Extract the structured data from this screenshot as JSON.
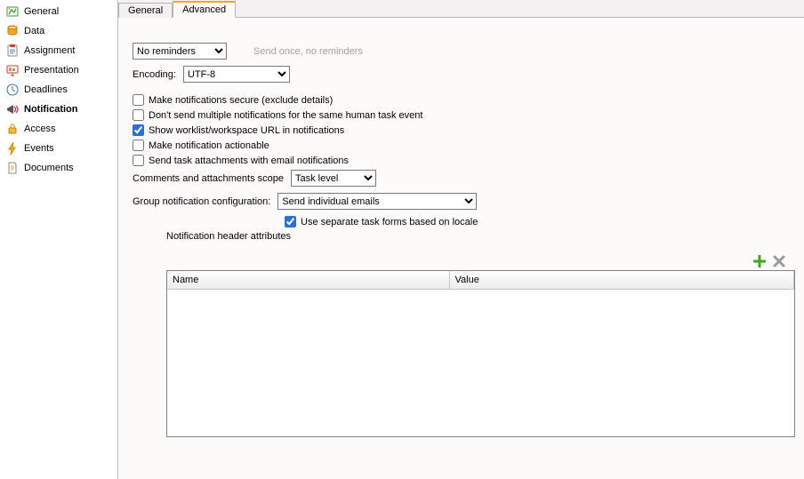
{
  "sidebar": {
    "items": [
      {
        "label": "General"
      },
      {
        "label": "Data"
      },
      {
        "label": "Assignment"
      },
      {
        "label": "Presentation"
      },
      {
        "label": "Deadlines"
      },
      {
        "label": "Notification"
      },
      {
        "label": "Access"
      },
      {
        "label": "Events"
      },
      {
        "label": "Documents"
      }
    ]
  },
  "tabs": {
    "general": "General",
    "advanced": "Advanced"
  },
  "form": {
    "reminders_value": "No reminders",
    "reminders_hint": "Send once, no reminders",
    "encoding_label": "Encoding:",
    "encoding_value": "UTF-8",
    "cb_secure": "Make notifications secure (exclude details)",
    "cb_nodup": "Don't send multiple notifications for the same human task event",
    "cb_url": "Show worklist/workspace URL in notifications",
    "cb_actionable": "Make notification actionable",
    "cb_attach": "Send task attachments with email notifications",
    "scope_label": "Comments and attachments scope",
    "scope_value": "Task level",
    "group_label": "Group notification configuration:",
    "group_value": "Send individual emails",
    "cb_locale": "Use separate task forms based on locale",
    "header_attrs_label": "Notification header attributes"
  },
  "table": {
    "col_name": "Name",
    "col_value": "Value",
    "rows": []
  },
  "colors": {
    "tab_active_top": "#f4a62a",
    "checkbox_accent": "#2a6fd6",
    "add_icon": "#3aa91c",
    "delete_icon": "#9a9a9a"
  }
}
